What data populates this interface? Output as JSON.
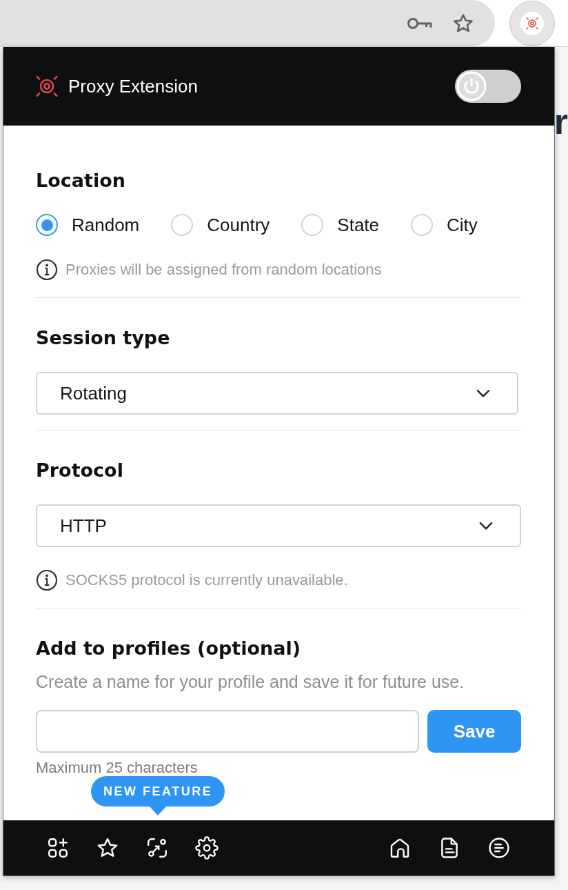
{
  "background_page": {
    "heading_fragment": "r"
  },
  "popup": {
    "header": {
      "title": "Proxy Extension",
      "power_toggle": {
        "on": false
      }
    },
    "location": {
      "heading": "Location",
      "options": [
        {
          "label": "Random",
          "selected": true
        },
        {
          "label": "Country",
          "selected": false
        },
        {
          "label": "State",
          "selected": false
        },
        {
          "label": "City",
          "selected": false
        }
      ],
      "info": "Proxies will be assigned from random locations"
    },
    "session_type": {
      "heading": "Session type",
      "select": {
        "value": "Rotating"
      }
    },
    "protocol": {
      "heading": "Protocol",
      "select": {
        "value": "HTTP"
      },
      "info": "SOCKS5 protocol is currently unavailable."
    },
    "profiles": {
      "heading": "Add to profiles (optional)",
      "description": "Create a name for your profile and save it for future use.",
      "save_button": "Save",
      "hint": "Maximum 25 characters"
    },
    "footer": {
      "badge": "NEW FEATURE"
    }
  }
}
